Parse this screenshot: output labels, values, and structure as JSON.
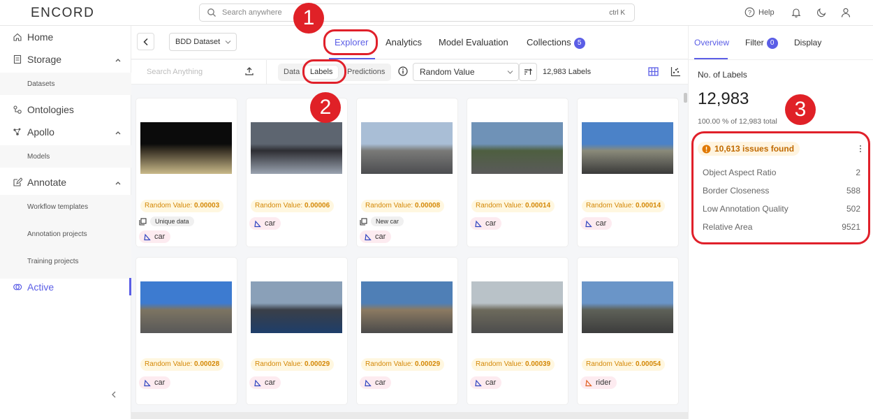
{
  "app": {
    "logo": "ENCORD"
  },
  "topbar": {
    "search_placeholder": "Search anywhere",
    "search_shortcut": "ctrl K",
    "help_label": "Help",
    "icons": [
      "search-icon",
      "help-icon",
      "bell-icon",
      "moon-icon",
      "user-icon"
    ]
  },
  "sidebar": {
    "items": [
      {
        "label": "Home",
        "icon": "home-icon"
      },
      {
        "label": "Storage",
        "icon": "storage-icon"
      },
      {
        "label": "Datasets"
      },
      {
        "label": "Ontologies",
        "icon": "ontology-icon"
      },
      {
        "label": "Apollo",
        "icon": "apollo-icon"
      },
      {
        "label": "Models"
      },
      {
        "label": "Annotate",
        "icon": "annotate-icon"
      },
      {
        "label": "Workflow templates"
      },
      {
        "label": "Annotation projects"
      },
      {
        "label": "Training projects"
      },
      {
        "label": "Active",
        "icon": "active-icon"
      }
    ]
  },
  "header": {
    "dataset": "BDD Dataset",
    "tabs": [
      "Explorer",
      "Analytics",
      "Model Evaluation",
      "Collections"
    ],
    "collections_count": "5"
  },
  "toolbar": {
    "search_placeholder": "Search Anything",
    "segments": [
      "Data",
      "Labels",
      "Predictions"
    ],
    "sort_value": "Random Value",
    "count": "12,983 Labels"
  },
  "cards": [
    {
      "rv_label": "Random Value:",
      "rv": "0.00003",
      "tag": "Unique data",
      "label": "car"
    },
    {
      "rv_label": "Random Value:",
      "rv": "0.00006",
      "tag": "",
      "label": "car"
    },
    {
      "rv_label": "Random Value:",
      "rv": "0.00008",
      "tag": "New car",
      "label": "car"
    },
    {
      "rv_label": "Random Value:",
      "rv": "0.00014",
      "tag": "",
      "label": "car"
    },
    {
      "rv_label": "Random Value:",
      "rv": "0.00014",
      "tag": "",
      "label": "car"
    },
    {
      "rv_label": "Random Value:",
      "rv": "0.00028",
      "tag": "",
      "label": "car"
    },
    {
      "rv_label": "Random Value:",
      "rv": "0.00029",
      "tag": "",
      "label": "car"
    },
    {
      "rv_label": "Random Value:",
      "rv": "0.00029",
      "tag": "",
      "label": "car"
    },
    {
      "rv_label": "Random Value:",
      "rv": "0.00039",
      "tag": "",
      "label": "car"
    },
    {
      "rv_label": "Random Value:",
      "rv": "0.00054",
      "tag": "",
      "label": "rider"
    }
  ],
  "right_panel": {
    "tabs": [
      "Overview",
      "Filter",
      "Display"
    ],
    "filter_count": "0",
    "no_of_labels_title": "No. of Labels",
    "total": "12,983",
    "percent_text": "100.00 % of 12,983 total",
    "issues_text": "10,613 issues found",
    "metrics": [
      {
        "name": "Object Aspect Ratio",
        "value": "2"
      },
      {
        "name": "Border Closeness",
        "value": "588"
      },
      {
        "name": "Low Annotation Quality",
        "value": "502"
      },
      {
        "name": "Relative Area",
        "value": "9521"
      }
    ]
  },
  "annotations": [
    "1",
    "2",
    "3"
  ],
  "colors": {
    "accent": "#5b5ee6",
    "annotation_red": "#e0202a",
    "warning": "#d48806",
    "label_pink": "#fdebf0"
  }
}
